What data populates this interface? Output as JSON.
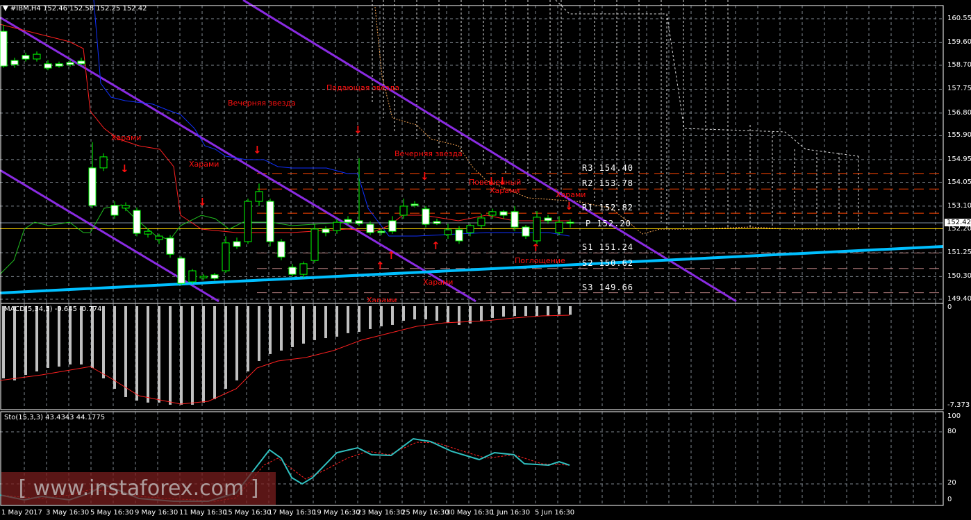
{
  "header": {
    "symbol": "#IBM,H4",
    "ohlc": "152.46 152.58 152.25 152.42"
  },
  "price_axis": [
    "160.55",
    "159.60",
    "158.70",
    "157.75",
    "156.80",
    "155.90",
    "154.95",
    "154.05",
    "153.10",
    "152.20",
    "151.25",
    "150.30",
    "149.40"
  ],
  "price_axis_values": [
    160.55,
    159.6,
    158.7,
    157.75,
    156.8,
    155.9,
    154.95,
    154.05,
    153.1,
    152.2,
    151.25,
    150.3,
    149.4
  ],
  "current_price": "152.42",
  "pivots": [
    {
      "label": "R3 154.40",
      "value": 154.4,
      "color": "#ff4500"
    },
    {
      "label": "R2 153.78",
      "value": 153.78,
      "color": "#ff4500"
    },
    {
      "label": "R1 152.82",
      "value": 152.82,
      "color": "#ff4500"
    },
    {
      "label": "P 152.20",
      "value": 152.2,
      "color": "#ffd700"
    },
    {
      "label": "S1 151.24",
      "value": 151.24,
      "color": "#b88080"
    },
    {
      "label": "S2 150.62",
      "value": 150.62,
      "color": "#b88080"
    },
    {
      "label": "S3 149.66",
      "value": 149.66,
      "color": "#b88080"
    }
  ],
  "patterns": [
    "Харами",
    "Харами",
    "Вечерняя звезда",
    "Падающая звезда",
    "Вечерняя звезда",
    "Повешенный",
    "Харами",
    "Харами",
    "Поглощение",
    "Харами",
    "Харами"
  ],
  "candles": [
    [
      158.67,
      160.05,
      160.3,
      158.6
    ],
    [
      158.73,
      158.89,
      159.0,
      158.6
    ],
    [
      158.95,
      159.09,
      159.2,
      158.85
    ],
    [
      159.14,
      158.95,
      159.25,
      158.85
    ],
    [
      158.59,
      158.76,
      158.9,
      158.5
    ],
    [
      158.67,
      158.76,
      158.85,
      158.6
    ],
    [
      158.73,
      158.81,
      158.95,
      158.65
    ],
    [
      158.76,
      158.87,
      159.0,
      158.7
    ],
    [
      153.13,
      154.62,
      155.64,
      153.02
    ],
    [
      155.06,
      154.62,
      155.2,
      154.5
    ],
    [
      152.74,
      153.13,
      153.3,
      152.6
    ],
    [
      153.13,
      153.02,
      153.25,
      152.9
    ],
    [
      152.02,
      152.93,
      153.05,
      151.9
    ],
    [
      152.1,
      151.99,
      152.2,
      151.85
    ],
    [
      151.91,
      151.77,
      152.0,
      151.6
    ],
    [
      151.19,
      151.83,
      151.95,
      151.05
    ],
    [
      150.03,
      151.03,
      151.1,
      149.95
    ],
    [
      150.53,
      150.09,
      150.6,
      150.0
    ],
    [
      150.31,
      150.25,
      150.4,
      150.15
    ],
    [
      150.23,
      150.37,
      150.45,
      150.15
    ],
    [
      151.64,
      150.53,
      151.9,
      150.45
    ],
    [
      151.5,
      151.69,
      151.85,
      151.4
    ],
    [
      153.29,
      151.69,
      153.4,
      151.6
    ],
    [
      153.68,
      153.29,
      154.0,
      153.1
    ],
    [
      151.69,
      153.29,
      153.4,
      151.5
    ],
    [
      151.08,
      151.69,
      151.8,
      150.95
    ],
    [
      150.39,
      150.67,
      150.8,
      150.3
    ],
    [
      150.81,
      150.39,
      150.9,
      150.25
    ],
    [
      152.19,
      150.94,
      152.4,
      150.85
    ],
    [
      152.05,
      152.19,
      152.3,
      151.9
    ],
    [
      152.46,
      152.13,
      152.6,
      152.0
    ],
    [
      152.46,
      152.57,
      152.7,
      152.35
    ],
    [
      152.41,
      152.52,
      155.0,
      152.3
    ],
    [
      152.05,
      152.38,
      152.5,
      151.95
    ],
    [
      152.05,
      152.1,
      152.2,
      151.95
    ],
    [
      152.1,
      152.52,
      152.7,
      152.0
    ],
    [
      153.1,
      152.74,
      153.4,
      152.6
    ],
    [
      153.13,
      153.18,
      153.3,
      153.05
    ],
    [
      152.38,
      152.99,
      153.1,
      152.25
    ],
    [
      152.41,
      152.49,
      152.6,
      152.35
    ],
    [
      152.16,
      151.97,
      152.4,
      151.8
    ],
    [
      151.72,
      152.16,
      152.3,
      151.6
    ],
    [
      152.33,
      152.05,
      152.4,
      151.9
    ],
    [
      152.63,
      152.33,
      152.8,
      152.2
    ],
    [
      152.88,
      152.74,
      153.0,
      152.6
    ],
    [
      152.74,
      152.88,
      152.95,
      152.6
    ],
    [
      152.27,
      152.88,
      153.1,
      152.1
    ],
    [
      151.91,
      152.27,
      152.35,
      151.8
    ],
    [
      152.66,
      151.72,
      152.9,
      151.6
    ],
    [
      152.52,
      152.63,
      152.75,
      152.4
    ],
    [
      152.46,
      152.05,
      152.7,
      151.95
    ],
    [
      152.42,
      152.46,
      152.58,
      152.25
    ]
  ],
  "macd": {
    "label": "MACD(5,34,5) -0.645 -0.774",
    "axis_top": "0",
    "axis_bottom": "-7.373",
    "histogram": [
      -5.4,
      -5.55,
      -5.14,
      -4.88,
      -4.62,
      -4.52,
      -4.36,
      -4.36,
      -4.62,
      -5.4,
      -6.18,
      -6.8,
      -7.06,
      -7.21,
      -7.21,
      -7.37,
      -7.37,
      -7.37,
      -7.21,
      -6.96,
      -6.18,
      -5.55,
      -4.88,
      -4.1,
      -3.58,
      -3.32,
      -3.06,
      -2.8,
      -2.54,
      -2.39,
      -2.28,
      -2.02,
      -1.92,
      -1.71,
      -1.51,
      -1.4,
      -1.09,
      -0.99,
      -0.99,
      -1.09,
      -1.25,
      -1.4,
      -1.3,
      -1.09,
      -0.88,
      -0.78,
      -0.73,
      -0.73,
      -0.73,
      -0.73,
      -0.62,
      -0.645
    ]
  },
  "stochastic": {
    "label": "Sto(15,3,3) 43.4343 44.1775",
    "axis": [
      "100",
      "80",
      "20",
      "0"
    ]
  },
  "dates": [
    "1 May 2017",
    "3 May 16:30",
    "5 May 16:30",
    "9 May 16:30",
    "11 May 16:30",
    "15 May 16:30",
    "17 May 16:30",
    "19 May 16:30",
    "23 May 16:30",
    "25 May 16:30",
    "30 May 16:30",
    "1 Jun 16:30",
    "5 Jun 16:30"
  ],
  "watermark": "[ www.instaforex.com ]",
  "colors": {
    "bull": "#ffffff",
    "bear": "#000000",
    "candle_border": "#00ff00",
    "support": "#00bfff",
    "channel": "#8a2be2",
    "pattern": "#ff1010"
  }
}
